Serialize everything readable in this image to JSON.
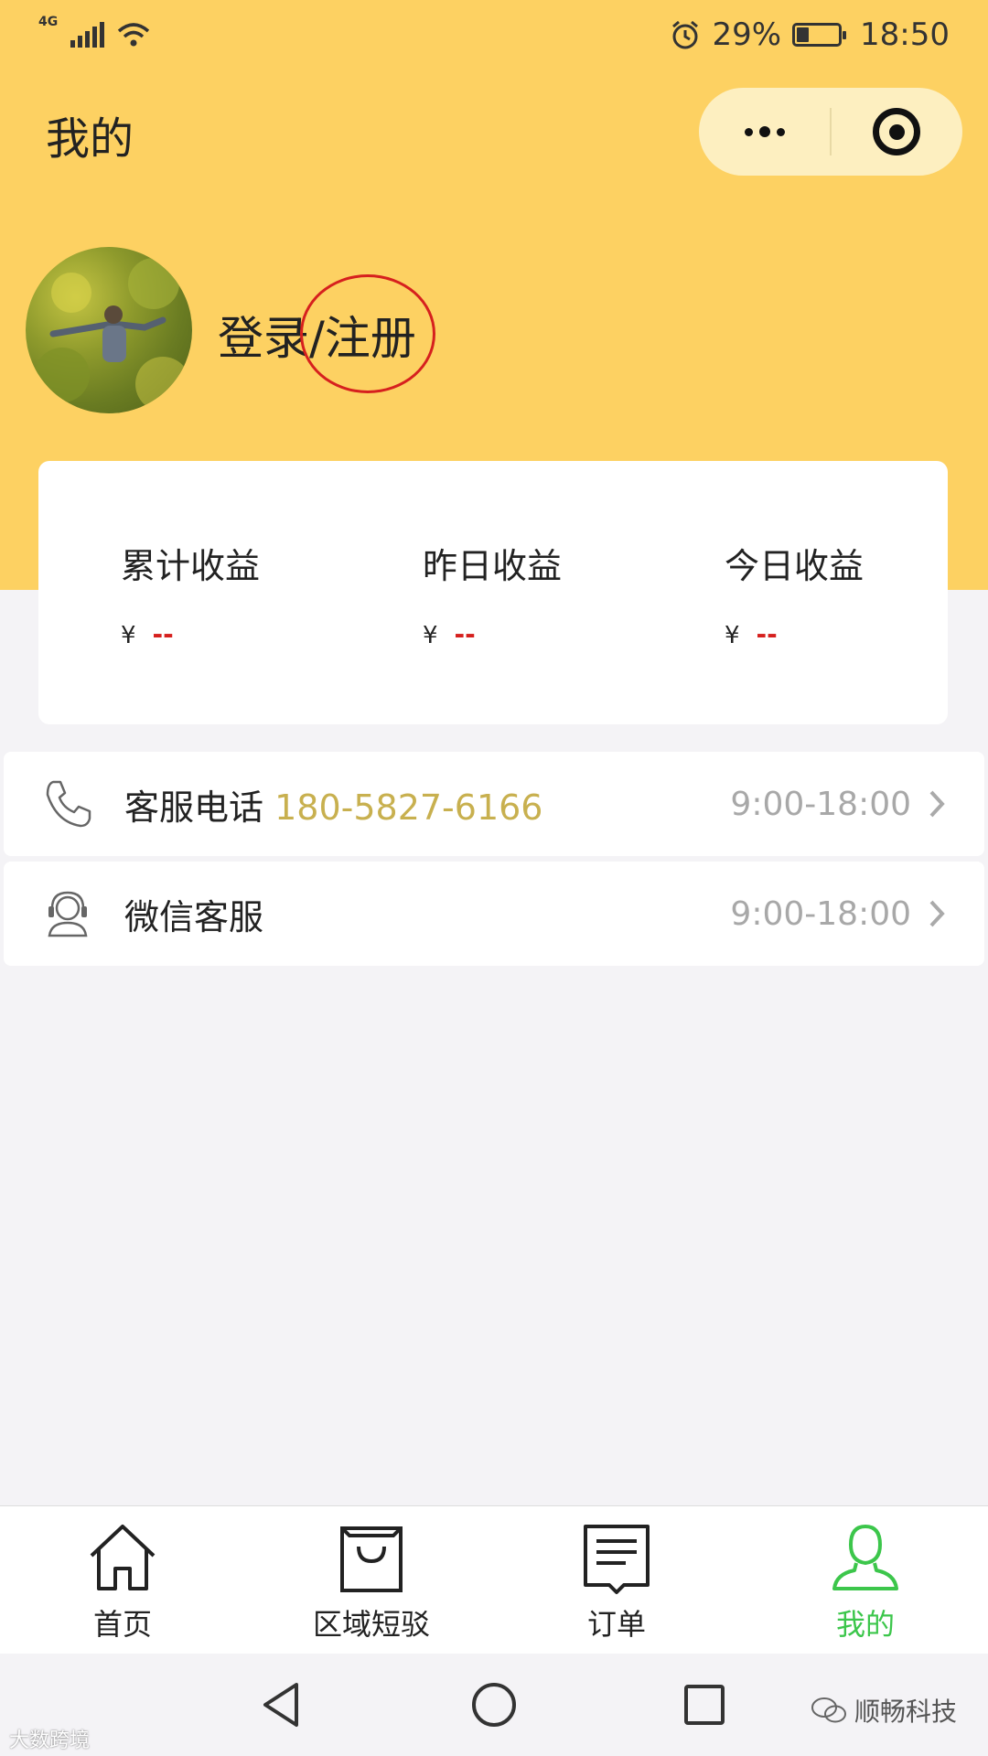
{
  "status_bar": {
    "network": "4G",
    "battery_percent": "29%",
    "battery_level": 0.29,
    "time": "18:50"
  },
  "header": {
    "title": "我的",
    "more_icon": "more-dots-icon",
    "close_icon": "target-close-icon"
  },
  "profile": {
    "login_label": "登录/注册"
  },
  "earnings": [
    {
      "label": "累计收益",
      "currency": "¥",
      "amount": "--"
    },
    {
      "label": "昨日收益",
      "currency": "¥",
      "amount": "--"
    },
    {
      "label": "今日收益",
      "currency": "¥",
      "amount": "--"
    }
  ],
  "service": {
    "phone_label": "客服电话",
    "phone_number": "180-5827-6166",
    "phone_hours": "9:00-18:00",
    "wechat_label": "微信客服",
    "wechat_hours": "9:00-18:00"
  },
  "bottom_nav": [
    {
      "label": "首页",
      "icon": "home-icon",
      "active": false
    },
    {
      "label": "区域短驳",
      "icon": "shopping-bag-icon",
      "active": false
    },
    {
      "label": "订单",
      "icon": "order-document-icon",
      "active": false
    },
    {
      "label": "我的",
      "icon": "user-icon",
      "active": true
    }
  ],
  "colors": {
    "header_yellow": "#fdd162",
    "active_green": "#3cc64b",
    "phone_gold": "#c8b04f",
    "amount_red": "#d6201e",
    "annotation_red": "#d6201e"
  },
  "watermarks": {
    "right": "顺畅科技",
    "left": "大数跨境"
  }
}
